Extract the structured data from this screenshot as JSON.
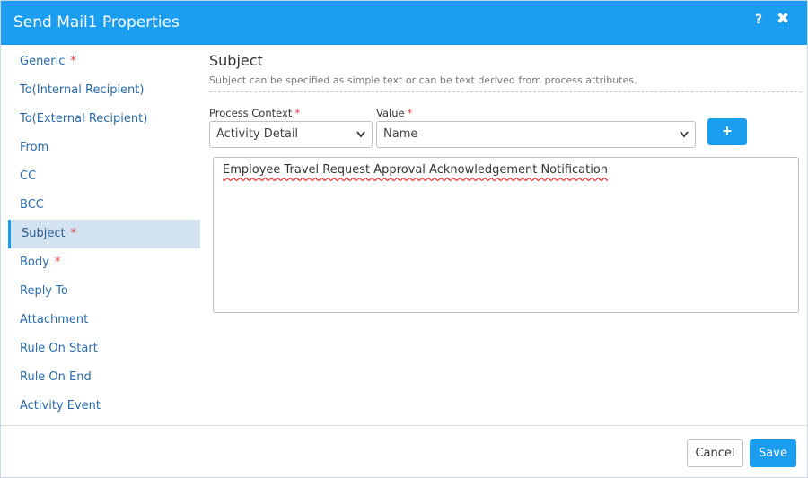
{
  "header": {
    "title": "Send Mail1 Properties",
    "help_glyph": "?",
    "close_glyph": "✖"
  },
  "sidebar": {
    "items": [
      {
        "label": "Generic",
        "required": true
      },
      {
        "label": "To(Internal Recipient)",
        "required": false
      },
      {
        "label": "To(External Recipient)",
        "required": false
      },
      {
        "label": "From",
        "required": false
      },
      {
        "label": "CC",
        "required": false
      },
      {
        "label": "BCC",
        "required": false
      },
      {
        "label": "Subject",
        "required": true,
        "active": true
      },
      {
        "label": "Body",
        "required": true
      },
      {
        "label": "Reply To",
        "required": false
      },
      {
        "label": "Attachment",
        "required": false
      },
      {
        "label": "Rule On Start",
        "required": false
      },
      {
        "label": "Rule On End",
        "required": false
      },
      {
        "label": "Activity Event",
        "required": false
      }
    ],
    "required_marker": "*"
  },
  "main": {
    "title": "Subject",
    "description": "Subject can be specified as simple text or can be text derived from process attributes.",
    "process_context": {
      "label": "Process Context",
      "value": "Activity Detail"
    },
    "value_field": {
      "label": "Value",
      "value": "Name"
    },
    "required_marker": "*",
    "add_button_label": "+",
    "subject_text": "Employee Travel Request Approval Acknowledgement Notification"
  },
  "footer": {
    "cancel_label": "Cancel",
    "save_label": "Save"
  },
  "colors": {
    "accent": "#1b9df0",
    "required": "#e03c3c",
    "active_item_bg": "#d3e2f0",
    "nav_text": "#2a6aa8"
  },
  "icons": {
    "help": "help-icon",
    "close": "close-icon",
    "dropdown": "chevron-down-icon",
    "add": "plus-icon"
  }
}
